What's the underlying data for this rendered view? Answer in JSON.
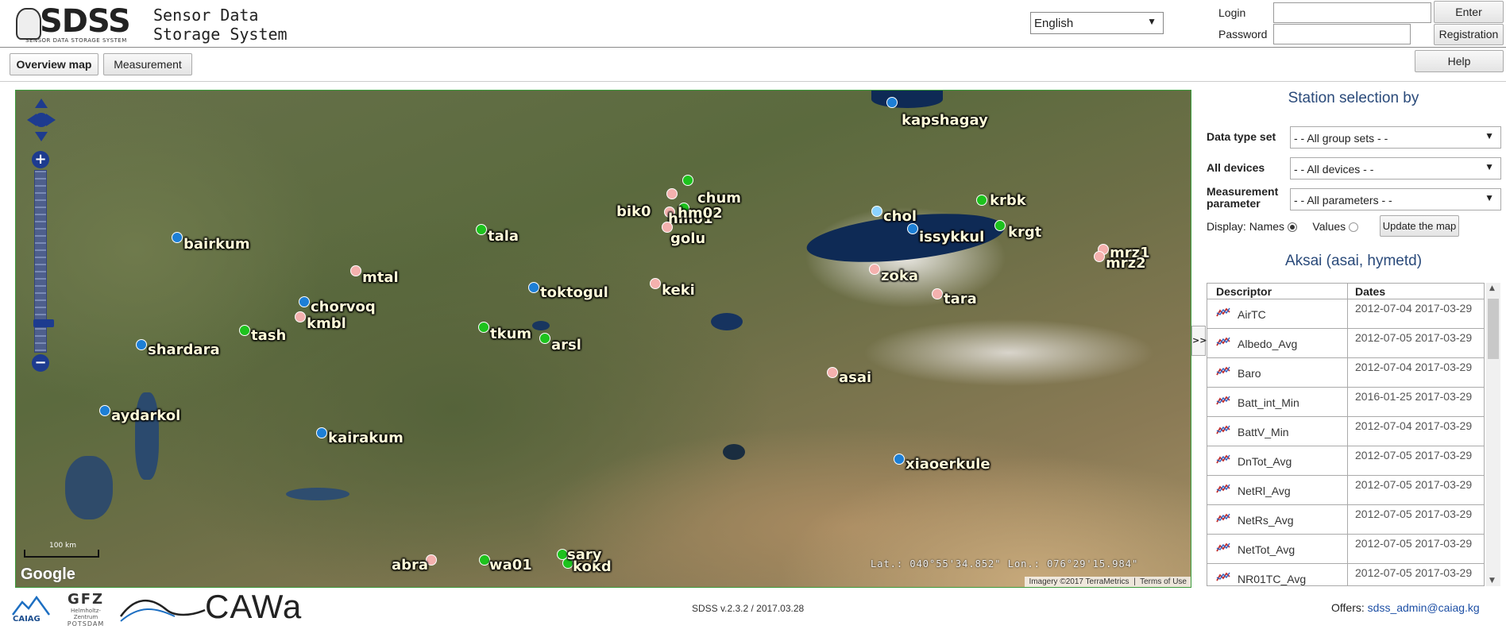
{
  "header": {
    "logo_text": "SDSS",
    "logo_subtitle": "SENSOR DATA STORAGE SYSTEM",
    "app_title_line1": "Sensor Data",
    "app_title_line2": "Storage System",
    "language": "English",
    "login_label": "Login",
    "password_label": "Password",
    "enter_button": "Enter",
    "registration_button": "Registration"
  },
  "toolbar": {
    "tabs": [
      {
        "label": "Overview map",
        "active": true
      },
      {
        "label": "Measurement",
        "active": false
      }
    ],
    "help_button": "Help"
  },
  "map": {
    "coordinates": "Lat.: 040°55'34.852\"   Lon.: 076°29'15.984\"",
    "attribution": "Imagery ©2017 TerraMetrics",
    "terms": "Terms of Use",
    "google": "Google",
    "scale": "100 km",
    "collapse_button": ">>",
    "stations": [
      {
        "name": "kapshagay",
        "color": "blue"
      },
      {
        "name": "chum",
        "color": "green"
      },
      {
        "name": "bik0",
        "color": "pink"
      },
      {
        "name": "hm01",
        "color": "pink"
      },
      {
        "name": "hm02",
        "color": "green"
      },
      {
        "name": "golu",
        "color": "pink"
      },
      {
        "name": "krbk",
        "color": "green"
      },
      {
        "name": "krgt",
        "color": "green"
      },
      {
        "name": "chol",
        "color": "cyan"
      },
      {
        "name": "issykkul",
        "color": "blue"
      },
      {
        "name": "zoka",
        "color": "pink"
      },
      {
        "name": "mrz1",
        "color": "pink"
      },
      {
        "name": "mrz2",
        "color": "pink"
      },
      {
        "name": "bairkum",
        "color": "blue"
      },
      {
        "name": "tala",
        "color": "green"
      },
      {
        "name": "mtal",
        "color": "pink"
      },
      {
        "name": "toktogul",
        "color": "blue"
      },
      {
        "name": "keki",
        "color": "pink"
      },
      {
        "name": "tara",
        "color": "pink"
      },
      {
        "name": "chorvoq",
        "color": "blue"
      },
      {
        "name": "kmbl",
        "color": "pink"
      },
      {
        "name": "tash",
        "color": "green"
      },
      {
        "name": "shardara",
        "color": "blue"
      },
      {
        "name": "tkum",
        "color": "green"
      },
      {
        "name": "arsl",
        "color": "green"
      },
      {
        "name": "asai",
        "color": "pink"
      },
      {
        "name": "aydarkol",
        "color": "blue"
      },
      {
        "name": "kairakum",
        "color": "blue"
      },
      {
        "name": "xiaoerkule",
        "color": "blue"
      },
      {
        "name": "abra",
        "color": "pink"
      },
      {
        "name": "wa01",
        "color": "green"
      },
      {
        "name": "kokd",
        "color": "green"
      },
      {
        "name": "sary",
        "color": "green"
      }
    ]
  },
  "panel": {
    "title": "Station selection by",
    "data_type_label": "Data type set",
    "data_type_value": "- - All group sets - -",
    "devices_label": "All devices",
    "devices_value": "- - All devices - -",
    "param_label_1": "Measurement",
    "param_label_2": "parameter",
    "param_value": "- - All parameters - -",
    "display_label": "Display:",
    "names_option": "Names",
    "values_option": "Values",
    "update_button": "Update the map",
    "station_title": "Aksai (asai, hymetd)",
    "table_headers": [
      "Descriptor",
      "Dates"
    ],
    "rows": [
      {
        "descriptor": "AirTC",
        "dates": "2012-07-04  2017-03-29"
      },
      {
        "descriptor": "Albedo_Avg",
        "dates": "2012-07-05  2017-03-29"
      },
      {
        "descriptor": "Baro",
        "dates": "2012-07-04  2017-03-29"
      },
      {
        "descriptor": "Batt_int_Min",
        "dates": "2016-01-25  2017-03-29"
      },
      {
        "descriptor": "BattV_Min",
        "dates": "2012-07-04  2017-03-29"
      },
      {
        "descriptor": "DnTot_Avg",
        "dates": "2012-07-05  2017-03-29"
      },
      {
        "descriptor": "NetRl_Avg",
        "dates": "2012-07-05  2017-03-29"
      },
      {
        "descriptor": "NetRs_Avg",
        "dates": "2012-07-05  2017-03-29"
      },
      {
        "descriptor": "NetTot_Avg",
        "dates": "2012-07-05  2017-03-29"
      },
      {
        "descriptor": "NR01TC_Avg",
        "dates": "2012-07-05  2017-03-29"
      }
    ]
  },
  "footer": {
    "caiag": "CAIAG",
    "gfz": "GFZ",
    "gfz_sub_1": "Helmholtz-Zentrum",
    "gfz_sub_2": "POTSDAM",
    "cawa": "CAWa",
    "version": "SDSS v.2.3.2 / 2017.03.28",
    "offers_label": "Offers:",
    "offers_email": "sdss_admin@caiag.kg"
  },
  "colors": {
    "blue": "#1d7fd6",
    "green": "#1dc21d",
    "pink": "#f4b1ae",
    "cyan": "#8bd2ff",
    "title_blue": "#2a4a7a"
  }
}
